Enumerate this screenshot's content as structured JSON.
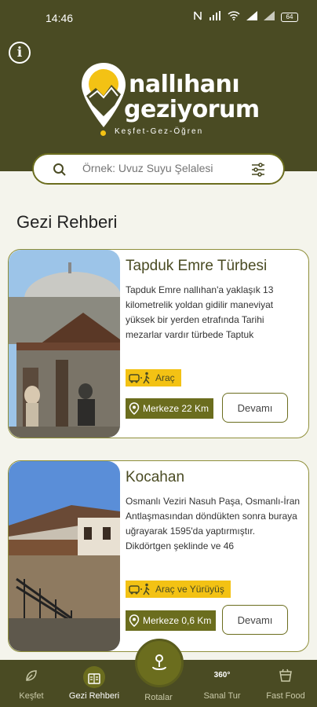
{
  "status_bar": {
    "time": "14:46",
    "battery": "64"
  },
  "logo": {
    "line1": "nallıhanı",
    "line2": "geziyorum",
    "tagline": "Keşfet-Gez-Öğren"
  },
  "search": {
    "placeholder": "Örnek: Uvuz Suyu Şelalesi"
  },
  "section_title": "Gezi Rehberi",
  "cards": [
    {
      "title": "Tapduk Emre Türbesi",
      "description": "Tapduk Emre nallıhan'a yaklaşık 13 kilometrelik yoldan gidilir maneviyat yüksek bir yerden etrafında Tarihi mezarlar vardır türbede Taptuk",
      "transport": "Araç",
      "distance": "Merkeze 22 Km",
      "button": "Devamı"
    },
    {
      "title": "Kocahan",
      "description": "Osmanlı Veziri Nasuh Paşa, Osmanlı-İran Antlaşmasından döndükten sonra buraya uğrayarak 1595'da yaptırmıştır. Dikdörtgen şeklinde ve 46",
      "transport": "Araç ve Yürüyüş",
      "distance": "Merkeze 0,6 Km",
      "button": "Devamı"
    }
  ],
  "nav": {
    "items": [
      {
        "label": "Keşfet"
      },
      {
        "label": "Gezi Rehberi"
      },
      {
        "label": "Rotalar"
      },
      {
        "label": "Sanal Tur"
      },
      {
        "label": "Fast Food"
      }
    ],
    "sanal_tur_badge": "360°"
  },
  "colors": {
    "header": "#4a4b23",
    "accent": "#6b6d1e",
    "highlight": "#f3c214"
  }
}
